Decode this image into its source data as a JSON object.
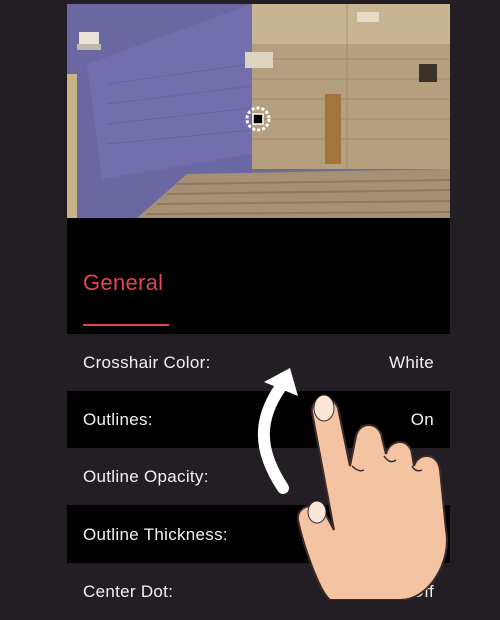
{
  "preview": {
    "scene": "game-map-crosshair-preview"
  },
  "section": {
    "title": "General"
  },
  "settings": [
    {
      "label": "Crosshair Color:",
      "value": "White"
    },
    {
      "label": "Outlines:",
      "value": "On"
    },
    {
      "label": "Outline Opacity:",
      "value": ""
    },
    {
      "label": "Outline Thickness:",
      "value": ""
    },
    {
      "label": "Center Dot:",
      "value": "Off"
    }
  ],
  "colors": {
    "accent": "#e2474f",
    "background": "#221e24",
    "panel": "#000000",
    "text": "#f2f2f2"
  },
  "gesture": {
    "icon": "swipe-up-hand-icon",
    "arrow": "arrow-up-icon"
  }
}
